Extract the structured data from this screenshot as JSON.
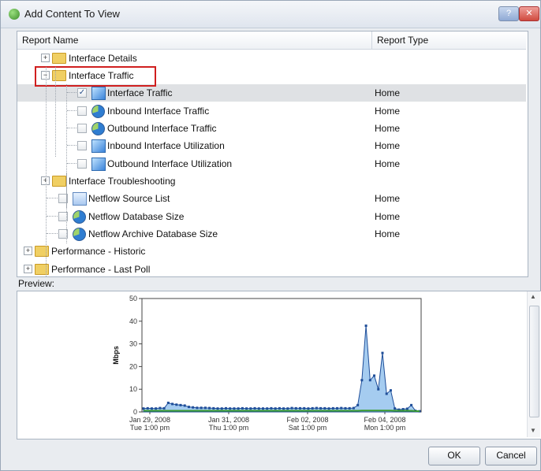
{
  "window": {
    "title": "Add Content To View",
    "help_icon": "help-icon",
    "close_icon": "close-icon"
  },
  "tree": {
    "headers": {
      "name": "Report Name",
      "type": "Report Type"
    },
    "rows": [
      {
        "kind": "folder",
        "label": "Interface Details",
        "type": ""
      },
      {
        "kind": "folder",
        "label": "Interface Traffic",
        "type": "",
        "open": true
      },
      {
        "kind": "chart",
        "label": "Interface Traffic",
        "type": "Home",
        "checked": true,
        "selected": true
      },
      {
        "kind": "pie",
        "label": "Inbound Interface Traffic",
        "type": "Home"
      },
      {
        "kind": "pie",
        "label": "Outbound Interface Traffic",
        "type": "Home"
      },
      {
        "kind": "chart",
        "label": "Inbound Interface Utilization",
        "type": "Home"
      },
      {
        "kind": "chart",
        "label": "Outbound Interface Utilization",
        "type": "Home"
      },
      {
        "kind": "folder",
        "label": "Interface Troubleshooting",
        "type": ""
      },
      {
        "kind": "list",
        "label": "Netflow Source List",
        "type": "Home"
      },
      {
        "kind": "pie",
        "label": "Netflow Database Size",
        "type": "Home"
      },
      {
        "kind": "pie",
        "label": "Netflow Archive Database Size",
        "type": "Home"
      },
      {
        "kind": "folder",
        "label": "Performance - Historic",
        "type": ""
      },
      {
        "kind": "folder",
        "label": "Performance - Last Poll",
        "type": ""
      }
    ]
  },
  "preview": {
    "label": "Preview:"
  },
  "chart_data": {
    "type": "area",
    "ylabel": "Mbps",
    "ylim": [
      0,
      50
    ],
    "yticks": [
      0,
      10,
      20,
      30,
      40,
      50
    ],
    "xtick_labels": [
      [
        "Jan 29, 2008",
        "Tue 1:00 pm"
      ],
      [
        "Jan 31, 2008",
        "Thu 1:00 pm"
      ],
      [
        "Feb 02, 2008",
        "Sat 1:00 pm"
      ],
      [
        "Feb 04, 2008",
        "Mon 1:00 pm"
      ]
    ],
    "series": [
      {
        "values": [
          1.5,
          1.6,
          1.5,
          1.5,
          1.7,
          1.6,
          4.0,
          3.5,
          3.2,
          3.0,
          2.8,
          2.2,
          2.0,
          1.8,
          1.8,
          1.8,
          1.7,
          1.6,
          1.5,
          1.5,
          1.6,
          1.5,
          1.5,
          1.5,
          1.6,
          1.5,
          1.5,
          1.6,
          1.5,
          1.5,
          1.5,
          1.6,
          1.5,
          1.6,
          1.5,
          1.5,
          1.7,
          1.6,
          1.6,
          1.6,
          1.5,
          1.6,
          1.7,
          1.6,
          1.6,
          1.5,
          1.6,
          1.6,
          1.7,
          1.6,
          1.6,
          1.7,
          3.0,
          14.0,
          38.0,
          14.0,
          16.0,
          10.0,
          26.0,
          8.0,
          9.5,
          1.5,
          1.0,
          1.2,
          1.4,
          3.0,
          0.5,
          0.3
        ],
        "color": "#1f4e99"
      },
      {
        "values": [
          0.5,
          0.5,
          0.5,
          0.5,
          0.5,
          0.5,
          0.5,
          0.5,
          0.5,
          0.5,
          0.5,
          0.5,
          0.5,
          0.5,
          0.5,
          0.5,
          0.5,
          0.5,
          0.5,
          0.5,
          0.5,
          0.5,
          0.5,
          0.5,
          0.5,
          0.5,
          0.5,
          0.5,
          0.5,
          0.5,
          0.5,
          0.5,
          0.5,
          0.5,
          0.5,
          0.5,
          0.5,
          0.5,
          0.5,
          0.5,
          0.5,
          0.5,
          0.5,
          0.5,
          0.5,
          0.5,
          0.5,
          0.5,
          0.5,
          0.5,
          0.5,
          0.5,
          0.5,
          0.6,
          0.6,
          0.6,
          0.6,
          0.6,
          0.6,
          0.6,
          0.6,
          0.5,
          0.5,
          0.5,
          0.5,
          0.5,
          0.4,
          0.3
        ],
        "color": "#3a9c2e"
      }
    ]
  },
  "buttons": {
    "ok": "OK",
    "cancel": "Cancel"
  }
}
